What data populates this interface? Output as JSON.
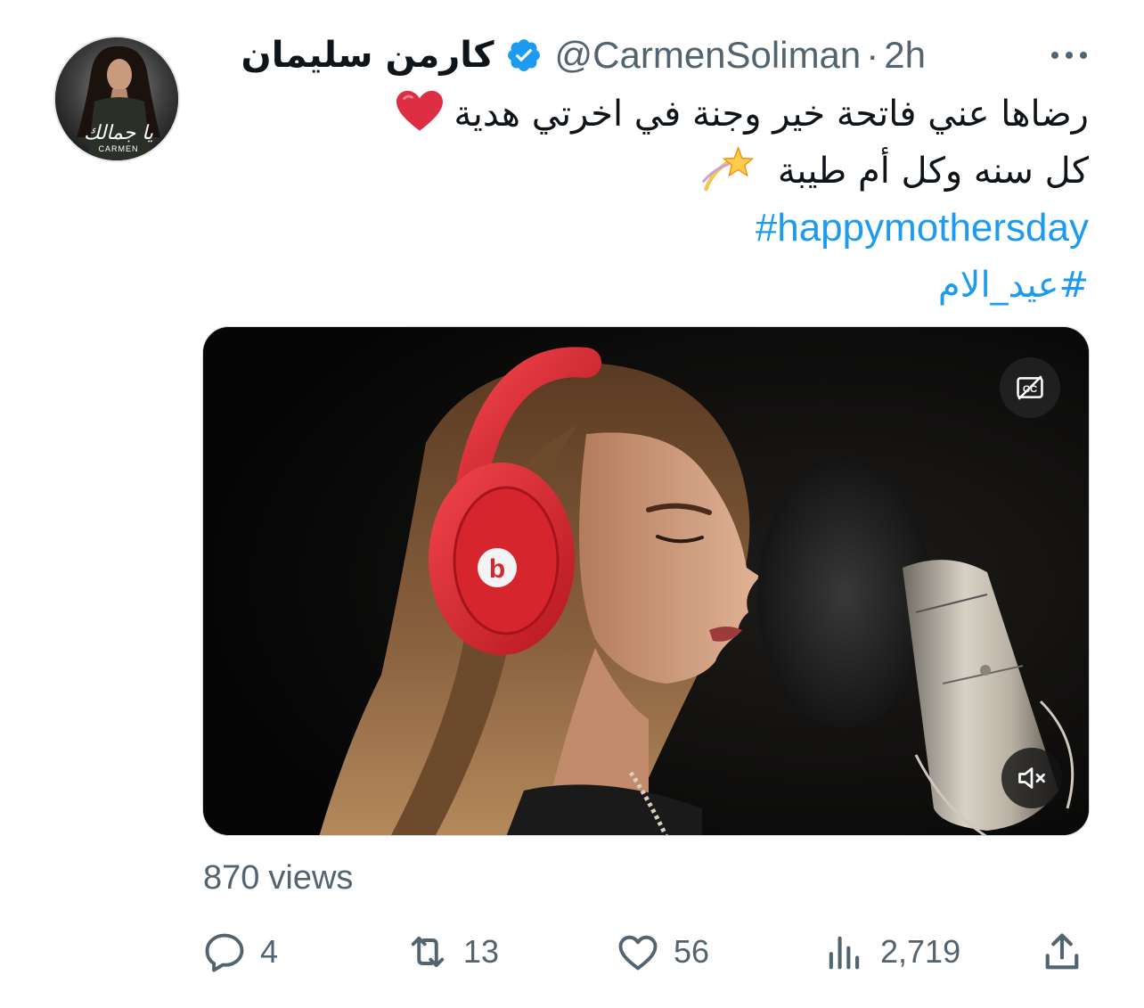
{
  "tweet": {
    "display_name": "كارمن سليمان",
    "handle": "@CarmenSoliman",
    "separator": "·",
    "time": "2h",
    "avatar_caption": "يا جمالك",
    "avatar_brand": "CARMEN",
    "text_line_1": "رضاها عني فاتحة خير وجنة في اخرتي هدية",
    "text_line_2": "كل سنه وكل أم طيبة",
    "hashtag_1": "#happymothersday",
    "hashtag_2": "#عيد_الام",
    "heart_emoji": "heart-emoji",
    "star_emoji": "dizzy-star-emoji"
  },
  "video": {
    "cc_icon": "closed-captions-off-icon",
    "mute_icon": "muted-speaker-icon",
    "headphone_brand": "b"
  },
  "stats": {
    "views_count": "870",
    "views_label": "views"
  },
  "actions": {
    "replies": "4",
    "retweets": "13",
    "likes": "56",
    "analytics": "2,719"
  },
  "colors": {
    "text": "#0f1419",
    "secondary": "#536471",
    "link": "#1d9bf0",
    "verified": "#1d9bf0",
    "headphone_red": "#d9262f"
  }
}
